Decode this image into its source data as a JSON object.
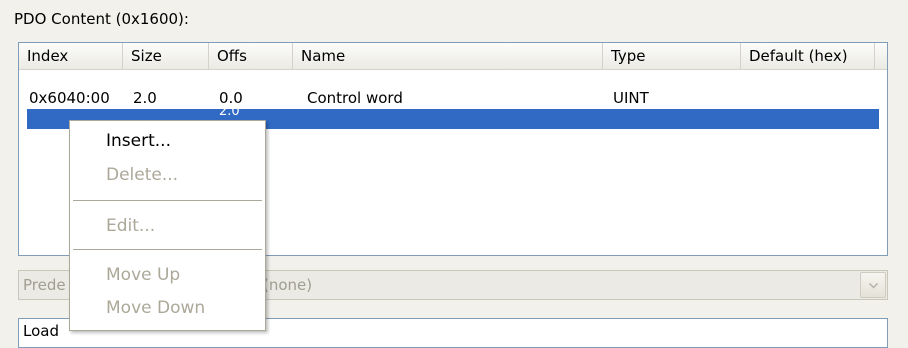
{
  "pdo_label": "PDO Content (0x1600):",
  "columns": [
    "Index",
    "Size",
    "Offs",
    "Name",
    "Type",
    "Default (hex)"
  ],
  "rows": [
    {
      "index": "0x6040:00",
      "size": "2.0",
      "offs": "0.0",
      "name": "Control word",
      "type": "UINT",
      "default": ""
    },
    {
      "index": "",
      "size": "",
      "offs": "2.0",
      "name": "",
      "type": "",
      "default": ""
    }
  ],
  "predefined": {
    "label": "Prede",
    "value": "(none)"
  },
  "load": {
    "label": "Load"
  },
  "context_menu": {
    "insert": "Insert...",
    "delete": "Delete...",
    "edit": "Edit...",
    "move_up": "Move Up",
    "move_down": "Move Down"
  },
  "colors": {
    "selection": "#316ac5",
    "disabled_text": "#aca899",
    "border": "#7f9db9"
  },
  "icons": {
    "combo_arrow": "chevron-down-icon"
  }
}
